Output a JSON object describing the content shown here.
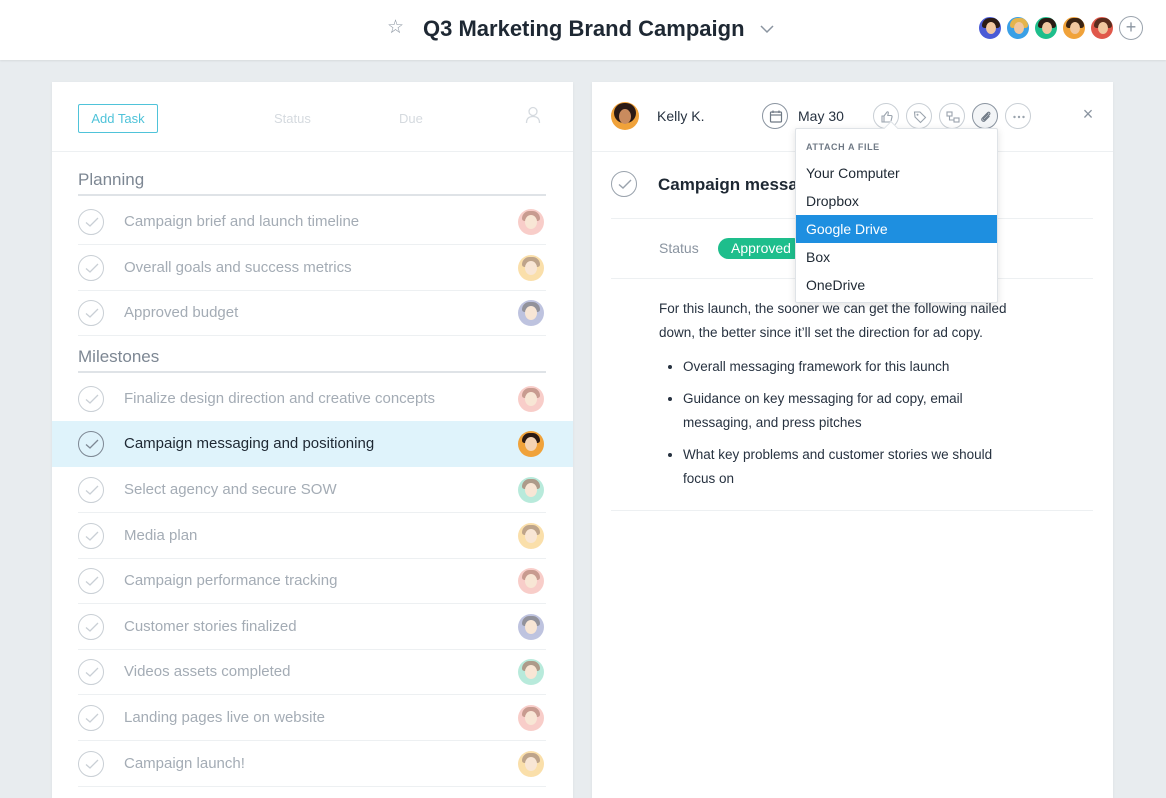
{
  "header": {
    "title": "Q3 Marketing Brand Campaign",
    "members": [
      {
        "bg": "#4a5bd6",
        "hair": "#2b1a14"
      },
      {
        "bg": "#3aa0e6",
        "hair": "#e4b44c"
      },
      {
        "bg": "#1ebe8c",
        "hair": "#2b1a14"
      },
      {
        "bg": "#f0a23a",
        "hair": "#3b2313"
      },
      {
        "bg": "#e0584a",
        "hair": "#5a2c1d"
      }
    ]
  },
  "toolbar": {
    "add_task_label": "Add Task",
    "status_label": "Status",
    "due_label": "Due"
  },
  "sections": [
    {
      "name": "Planning",
      "tasks": [
        {
          "label": "Campaign brief and launch timeline",
          "avatar": "#f3a69d",
          "hair": "#9c4a36"
        },
        {
          "label": "Overall goals and success metrics",
          "avatar": "#f6c566",
          "hair": "#8a5a2b"
        },
        {
          "label": "Approved budget",
          "avatar": "#8a93c6",
          "hair": "#3a3a4a"
        }
      ]
    },
    {
      "name": "Milestones",
      "tasks": [
        {
          "label": "Finalize design direction and creative concepts",
          "avatar": "#f3a69d",
          "hair": "#9c4a36"
        },
        {
          "label": "Campaign messaging and positioning",
          "avatar": "#f0a23a",
          "hair": "#2b1a14",
          "selected": true
        },
        {
          "label": "Select agency and secure SOW",
          "avatar": "#7fd9bf",
          "hair": "#6b4a2b"
        },
        {
          "label": "Media plan",
          "avatar": "#f6c566",
          "hair": "#8a5a2b"
        },
        {
          "label": "Campaign performance tracking",
          "avatar": "#f3a69d",
          "hair": "#9c4a36"
        },
        {
          "label": "Customer stories finalized",
          "avatar": "#8a93c6",
          "hair": "#3a3a4a"
        },
        {
          "label": "Videos assets completed",
          "avatar": "#7fd9bf",
          "hair": "#6b4a2b"
        },
        {
          "label": "Landing pages live on website",
          "avatar": "#f3a69d",
          "hair": "#9c4a36"
        },
        {
          "label": "Campaign launch!",
          "avatar": "#f6c566",
          "hair": "#8a5a2b"
        }
      ]
    }
  ],
  "detail": {
    "assignee": "Kelly K.",
    "due_date": "May 30",
    "title": "Campaign messaging and positioning",
    "status_label": "Status",
    "status_value": "Approved",
    "description": "For this launch, the sooner we can get the following nailed down, the better since it’ll set the direction for ad copy.",
    "bullets": [
      "Overall messaging framework for this launch",
      "Guidance on key messaging for ad copy, email messaging, and press pitches",
      "What key problems and customer stories we should focus on"
    ]
  },
  "attach_menu": {
    "heading": "ATTACH A FILE",
    "items": [
      "Your Computer",
      "Dropbox",
      "Google Drive",
      "Box",
      "OneDrive"
    ],
    "highlighted": "Google Drive"
  },
  "colors": {
    "accent": "#4fc3d9",
    "selected_row": "#dff3fb",
    "approved": "#1ebe8c",
    "menu_highlight": "#1e8fe0"
  }
}
